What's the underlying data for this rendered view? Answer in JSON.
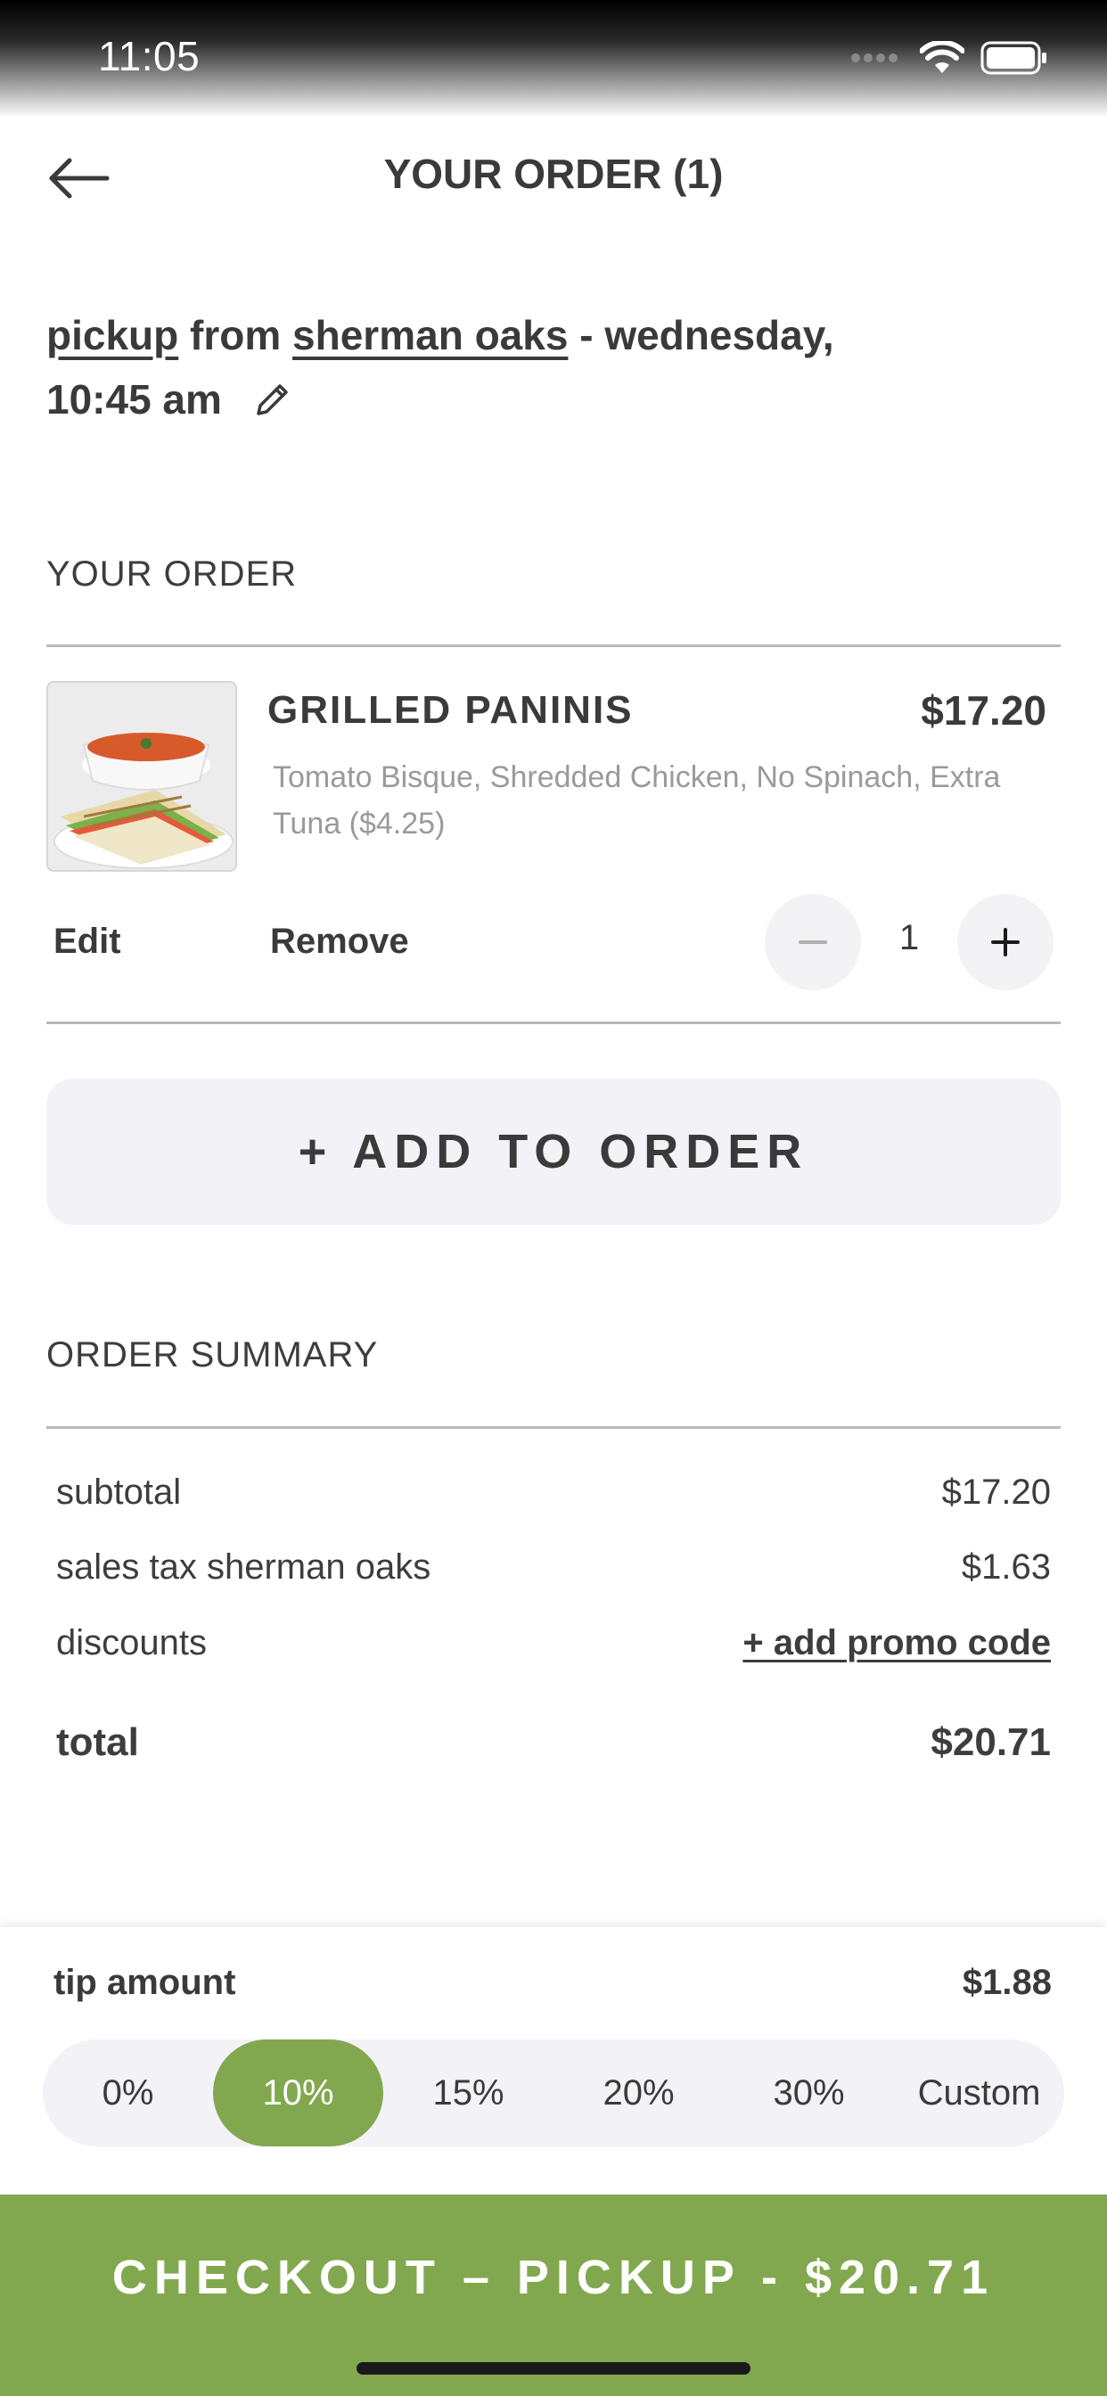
{
  "status_bar": {
    "time": "11:05"
  },
  "header": {
    "title": "YOUR ORDER (1)"
  },
  "pickup": {
    "mode": "pickup",
    "from_word": "from",
    "location": "sherman oaks",
    "when": "- wednesday,",
    "time": "10:45 am"
  },
  "order_section": {
    "title": "YOUR ORDER"
  },
  "item": {
    "name": "GRILLED PANINIS",
    "price": "$17.20",
    "modifiers": "Tomato Bisque, Shredded Chicken, No Spinach, Extra Tuna ($4.25)",
    "quantity": "1",
    "edit_label": "Edit",
    "remove_label": "Remove"
  },
  "add_to_order_label": "+ ADD TO ORDER",
  "summary": {
    "title": "ORDER SUMMARY",
    "subtotal_label": "subtotal",
    "subtotal_value": "$17.20",
    "tax_label": "sales tax sherman oaks",
    "tax_value": "$1.63",
    "discounts_label": "discounts",
    "promo_label": "+ add promo code",
    "total_label": "total",
    "total_value": "$20.71"
  },
  "tip": {
    "label": "tip amount",
    "amount": "$1.88",
    "options": [
      "0%",
      "10%",
      "15%",
      "20%",
      "30%",
      "Custom"
    ],
    "selected": "10%"
  },
  "checkout_label": "CHECKOUT – PICKUP - $20.71",
  "colors": {
    "accent": "#82a84f",
    "text": "#3a3a3a",
    "muted": "#9a9a9a",
    "button_bg": "#f3f3f7"
  }
}
